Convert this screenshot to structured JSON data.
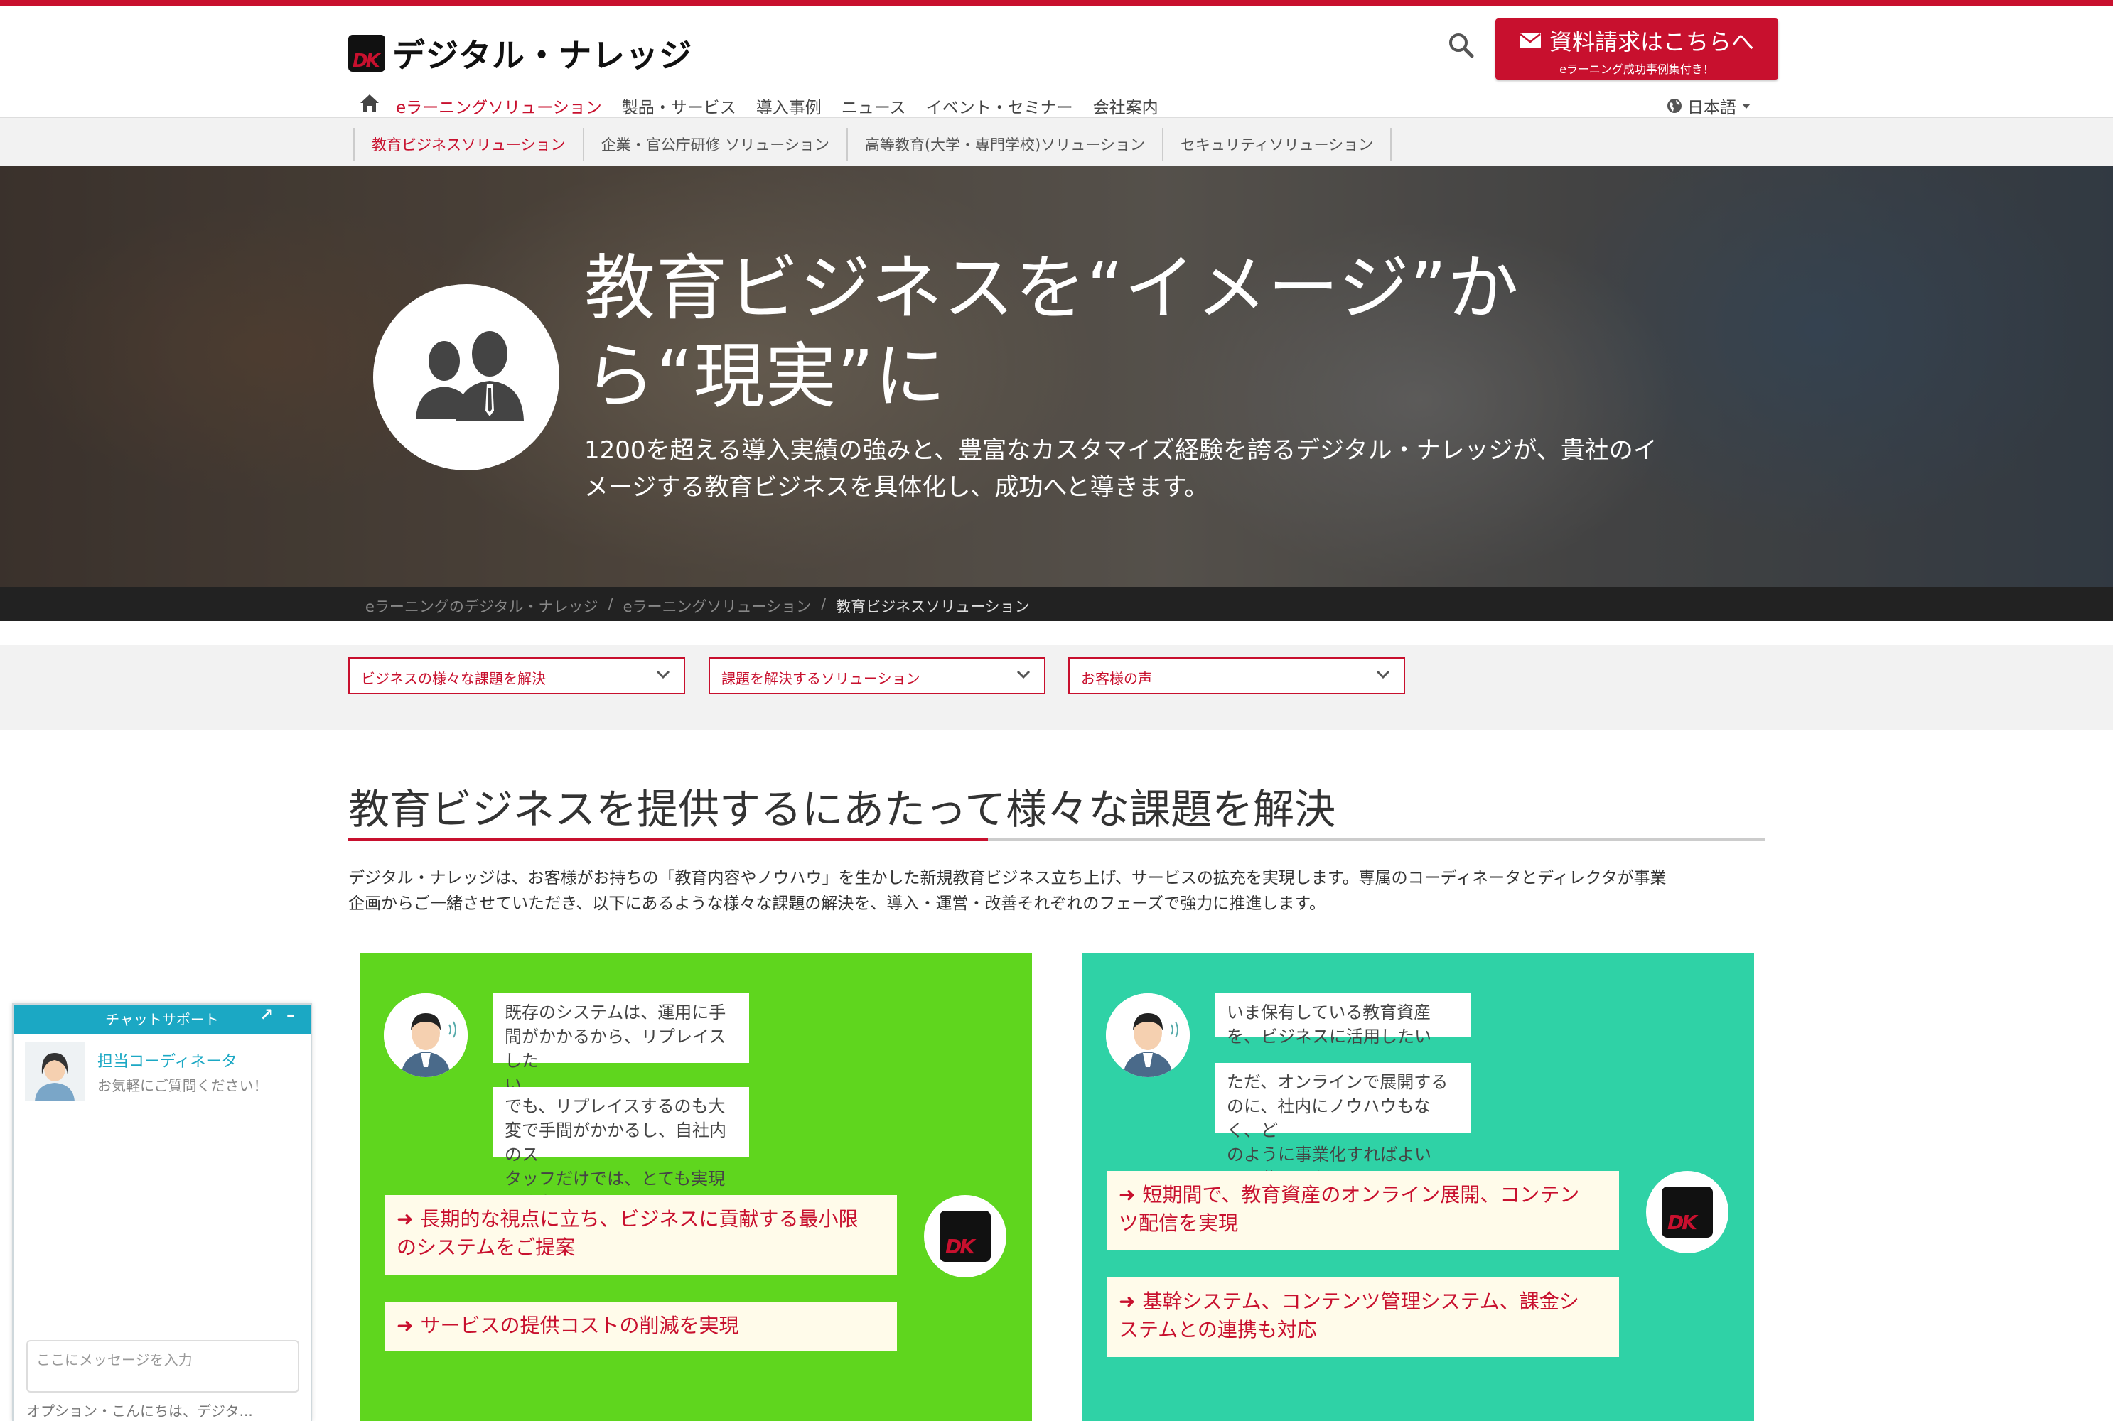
{
  "header": {
    "logo_text": "デジタル・ナレッジ",
    "cta_main": "資料請求はこちらへ",
    "cta_sub": "eラーニング成功事例集付き！",
    "nav": [
      {
        "label": "eラーニングソリューション"
      },
      {
        "label": "製品・サービス"
      },
      {
        "label": "導入事例"
      },
      {
        "label": "ニュース"
      },
      {
        "label": "イベント・セミナー"
      },
      {
        "label": "会社案内"
      }
    ],
    "language": "日本語"
  },
  "subnav": [
    {
      "label": "教育ビジネスソリューション"
    },
    {
      "label": "企業・官公庁研修 ソリューション"
    },
    {
      "label": "高等教育(大学・専門学校)ソリューション"
    },
    {
      "label": "セキュリティソリューション"
    }
  ],
  "hero": {
    "title_line1": "教育ビジネスを“イメージ”か",
    "title_line2": "ら“現実”に",
    "text_line1": "1200を超える導入実績の強みと、豊富なカスタマイズ経験を誇るデジタル・ナレッジが、貴社のイ",
    "text_line2": "メージする教育ビジネスを具体化し、成功へと導きます。"
  },
  "breadcrumb": {
    "items": [
      "eラーニングのデジタル・ナレッジ",
      "eラーニングソリューション"
    ],
    "separator": "/",
    "current": "教育ビジネスソリューション"
  },
  "selects": [
    {
      "value": "ビジネスの様々な課題を解決"
    },
    {
      "value": "課題を解決するソリューション"
    },
    {
      "value": "お客様の声"
    }
  ],
  "section": {
    "title": "教育ビジネスを提供するにあたって様々な課題を解決",
    "intro_line1": "デジタル・ナレッジは、お客様がお持ちの「教育内容やノウハウ」を生かした新規教育ビジネス立ち上げ、サービスの拡充を実現します。専属のコーディネータとディレクタが事業",
    "intro_line2": "企画からご一緒させていただき、以下にあるような様々な課題の解決を、導入・運営・改善それぞれのフェーズで強力に推進します。"
  },
  "cards": [
    {
      "color": "#5fd61e",
      "concern1_l1": "既存のシステムは、運用に手間がかかるから、リプレイスした",
      "concern1_l2": "い",
      "concern2_l1": "でも、リプレイスするのも大変で手間がかかるし、自社内のス",
      "concern2_l2": "タッフだけでは、とても実現できない",
      "solution1_l1": "長期的な視点に立ち、ビジネスに貢献する最小限",
      "solution1_l2": "のシステムをご提案",
      "solution2_l1": "サービスの提供コストの削減を実現"
    },
    {
      "color": "#2fd2a6",
      "concern1_l1": "いま保有している教育資産を、ビジネスに活用したい",
      "concern2_l1": "ただ、オンラインで展開するのに、社内にノウハウもなく、ど",
      "concern2_l2": "のように事業化すればよいか、分からない",
      "solution1_l1": "短期間で、教育資産のオンライン展開、コンテン",
      "solution1_l2": "ツ配信を実現",
      "solution2_l1": "基幹システム、コンテンツ管理システム、課金シ",
      "solution2_l2": "ステムとの連携も対応"
    }
  ],
  "chat": {
    "title": "チャットサポート",
    "expand": "↗",
    "minimize": "–",
    "agent_name": "担当コーディネータ",
    "agent_sub": "お気軽にご質問ください！",
    "input_placeholder": "ここにメッセージを入力",
    "footer": "オプション・こんにちは、デジタ..."
  },
  "colors": {
    "accent": "#c8102e",
    "chat_header": "#1ba8c4"
  }
}
